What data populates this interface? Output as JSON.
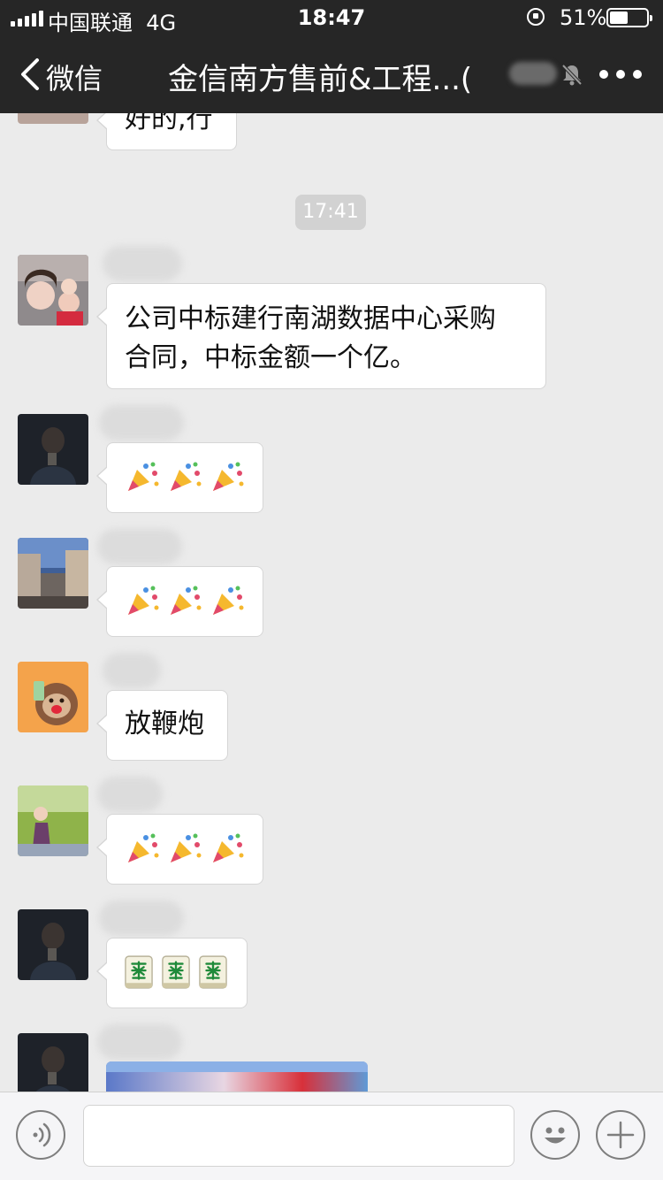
{
  "status_bar": {
    "carrier": "中国联通",
    "network": "4G",
    "time": "18:47",
    "battery_percent": "51%",
    "battery_level": 0.51
  },
  "nav": {
    "back_label": "微信",
    "title": "金信南方售前&工程...(",
    "muted": true
  },
  "chat": {
    "timestamp": "17:41",
    "messages": [
      {
        "type": "text",
        "text": "好的,行"
      },
      {
        "type": "text",
        "text_line1": "公司中标建行南湖数据中心采购",
        "text_line2": "合同，中标金额一个亿。"
      },
      {
        "type": "emoji",
        "emoji": "party-popper",
        "count": 3
      },
      {
        "type": "emoji",
        "emoji": "party-popper",
        "count": 3
      },
      {
        "type": "text",
        "text": "放鞭炮"
      },
      {
        "type": "emoji",
        "emoji": "party-popper",
        "count": 3
      },
      {
        "type": "emoji",
        "emoji": "mahjong-fa",
        "count": 3
      },
      {
        "type": "image"
      }
    ]
  },
  "colors": {
    "header_bg": "#262626",
    "chat_bg": "#ebebeb",
    "bubble_bg": "#ffffff",
    "input_bg": "#f5f5f7"
  },
  "icons": [
    "signal-icon",
    "screen-lock-icon",
    "battery-icon",
    "back-chevron-icon",
    "mute-bell-icon",
    "more-icon",
    "voice-icon",
    "emoji-icon",
    "plus-icon"
  ]
}
